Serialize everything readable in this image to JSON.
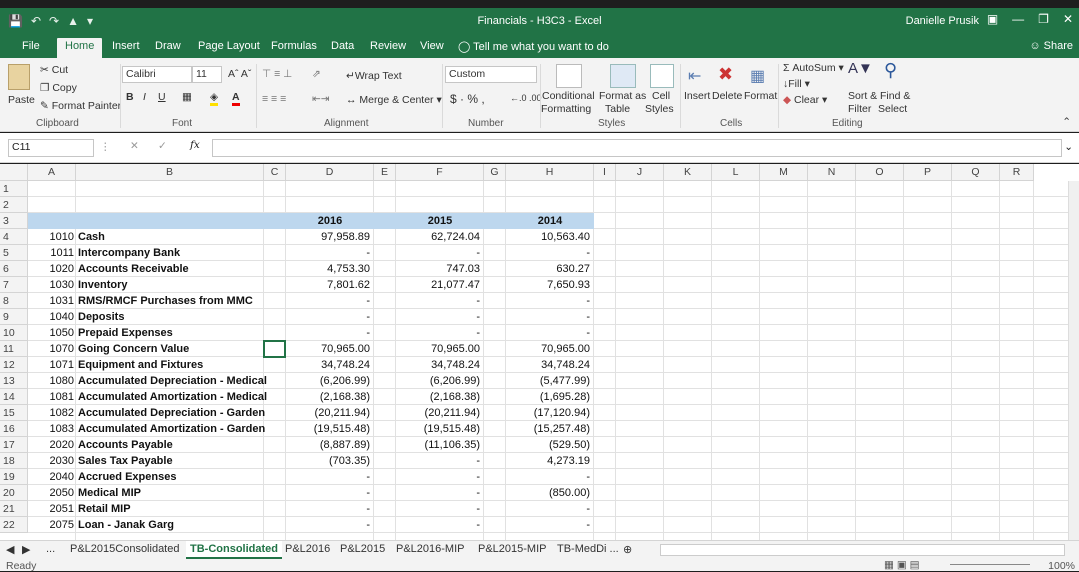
{
  "titlebar": {
    "title": "Financials - H3C3  -  Excel",
    "user": "Danielle Prusik"
  },
  "ribbon_tabs": [
    "File",
    "Home",
    "Insert",
    "Draw",
    "Page Layout",
    "Formulas",
    "Data",
    "Review",
    "View"
  ],
  "tell_me": "Tell me what you want to do",
  "share": "Share",
  "clipboard": {
    "paste": "Paste",
    "cut": "Cut",
    "copy": "Copy",
    "format_painter": "Format Painter",
    "label": "Clipboard"
  },
  "font": {
    "name": "Calibri",
    "size": "11",
    "label": "Font"
  },
  "alignment": {
    "wrap": "Wrap Text",
    "merge": "Merge & Center",
    "label": "Alignment"
  },
  "number": {
    "format": "Custom",
    "label": "Number"
  },
  "styles": {
    "cond": "Conditional",
    "cond2": "Formatting",
    "fmt_table": "Format as",
    "fmt_table2": "Table",
    "cell_styles": "Cell",
    "cell_styles2": "Styles",
    "label": "Styles"
  },
  "cells": {
    "insert": "Insert",
    "delete": "Delete",
    "format": "Format",
    "label": "Cells"
  },
  "editing": {
    "autosum": "AutoSum",
    "fill": "Fill",
    "clear": "Clear",
    "sort": "Sort &",
    "sort2": "Filter",
    "find": "Find &",
    "find2": "Select",
    "label": "Editing"
  },
  "namebox": "C11",
  "columns": [
    "A",
    "B",
    "C",
    "D",
    "E",
    "F",
    "G",
    "H",
    "I",
    "J",
    "K",
    "L",
    "M",
    "N",
    "O",
    "P",
    "Q",
    "R"
  ],
  "rows": [
    "1",
    "2",
    "3",
    "4",
    "5",
    "6",
    "7",
    "8",
    "9",
    "10",
    "11",
    "12",
    "13",
    "14",
    "15",
    "16",
    "17",
    "18",
    "19",
    "20",
    "21",
    "22"
  ],
  "years": [
    "2016",
    "2015",
    "2014"
  ],
  "table": [
    {
      "code": "1010",
      "name": "Cash",
      "d": "97,958.89",
      "f": "62,724.04",
      "h": "10,563.40"
    },
    {
      "code": "1011",
      "name": "Intercompany Bank",
      "d": "-",
      "f": "-",
      "h": "-"
    },
    {
      "code": "1020",
      "name": "Accounts Receivable",
      "d": "4,753.30",
      "f": "747.03",
      "h": "630.27"
    },
    {
      "code": "1030",
      "name": "Inventory",
      "d": "7,801.62",
      "f": "21,077.47",
      "h": "7,650.93"
    },
    {
      "code": "1031",
      "name": "RMS/RMCF Purchases from MMC",
      "d": "-",
      "f": "-",
      "h": "-"
    },
    {
      "code": "1040",
      "name": "Deposits",
      "d": "-",
      "f": "-",
      "h": "-"
    },
    {
      "code": "1050",
      "name": "Prepaid Expenses",
      "d": "-",
      "f": "-",
      "h": "-"
    },
    {
      "code": "1070",
      "name": "Going Concern Value",
      "d": "70,965.00",
      "f": "70,965.00",
      "h": "70,965.00"
    },
    {
      "code": "1071",
      "name": "Equipment and Fixtures",
      "d": "34,748.24",
      "f": "34,748.24",
      "h": "34,748.24"
    },
    {
      "code": "1080",
      "name": "Accumulated Depreciation - Medical",
      "d": "(6,206.99)",
      "f": "(6,206.99)",
      "h": "(5,477.99)"
    },
    {
      "code": "1081",
      "name": "Accumulated Amortization - Medical",
      "d": "(2,168.38)",
      "f": "(2,168.38)",
      "h": "(1,695.28)"
    },
    {
      "code": "1082",
      "name": "Accumulated Depreciation - Garden",
      "d": "(20,211.94)",
      "f": "(20,211.94)",
      "h": "(17,120.94)"
    },
    {
      "code": "1083",
      "name": "Accumulated Amortization - Garden",
      "d": "(19,515.48)",
      "f": "(19,515.48)",
      "h": "(15,257.48)"
    },
    {
      "code": "2020",
      "name": "Accounts Payable",
      "d": "(8,887.89)",
      "f": "(11,106.35)",
      "h": "(529.50)"
    },
    {
      "code": "2030",
      "name": "Sales Tax Payable",
      "d": "(703.35)",
      "f": "-",
      "h": "4,273.19"
    },
    {
      "code": "2040",
      "name": "Accrued Expenses",
      "d": "-",
      "f": "-",
      "h": "-"
    },
    {
      "code": "2050",
      "name": "Medical MIP",
      "d": "-",
      "f": "-",
      "h": "(850.00)"
    },
    {
      "code": "2051",
      "name": "Retail MIP",
      "d": "-",
      "f": "-",
      "h": "-"
    },
    {
      "code": "2075",
      "name": "Loan - Janak Garg",
      "d": "-",
      "f": "-",
      "h": "-"
    }
  ],
  "sheets": [
    "P&L2015Consolidated",
    "TB-Consolidated",
    "P&L2016",
    "P&L2015",
    "P&L2016-MIP",
    "P&L2015-MIP",
    "TB-MedDi ..."
  ],
  "status": {
    "ready": "Ready",
    "zoom": "100%"
  },
  "colors": {
    "excel_green": "#217346",
    "header_fill": "#bdd7ee"
  }
}
